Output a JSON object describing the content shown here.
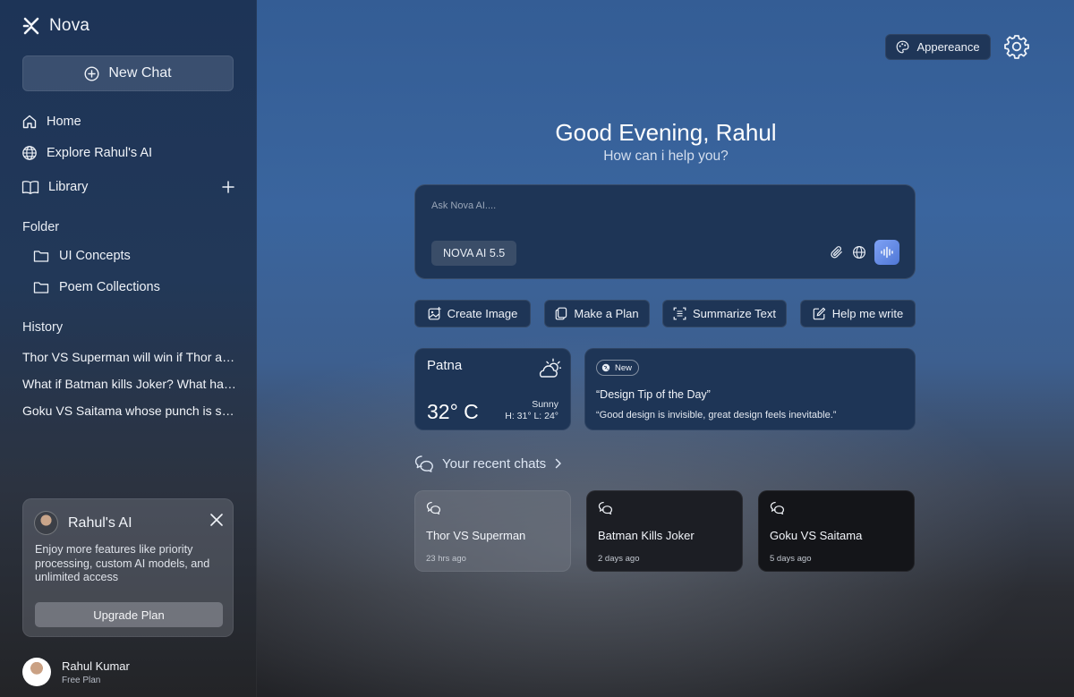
{
  "brand": {
    "name": "Nova",
    "icon": "nova-x-logo-icon"
  },
  "sidebar": {
    "new_chat": "New Chat",
    "nav": [
      {
        "label": "Home",
        "icon": "home-icon"
      },
      {
        "label": "Explore Rahul's AI",
        "icon": "globe-icon"
      },
      {
        "label": "Library",
        "icon": "book-icon"
      }
    ],
    "folder_label": "Folder",
    "folders": [
      "UI Concepts",
      "Poem Collections"
    ],
    "history_label": "History",
    "history": [
      "Thor VS Superman will win if Thor and Superman fight",
      "What if Batman kills Joker? What happens next",
      "Goku VS Saitama whose punch is stronger"
    ],
    "promo": {
      "title": "Rahul's AI",
      "description": "Enjoy more features like priority processing, custom AI models, and unlimited access",
      "button": "Upgrade Plan"
    },
    "user": {
      "name": "Rahul Kumar",
      "plan": "Free Plan"
    }
  },
  "topbar": {
    "appearance": "Appereance"
  },
  "greeting": {
    "title": "Good Evening, Rahul",
    "subtitle": "How can i help you?"
  },
  "prompt": {
    "placeholder": "Ask Nova AI....",
    "value": "",
    "model": "NOVA AI 5.5"
  },
  "actions": [
    {
      "label": "Create Image",
      "icon": "image-plus-icon"
    },
    {
      "label": "Make a Plan",
      "icon": "copy-icon"
    },
    {
      "label": "Summarize Text",
      "icon": "scan-text-icon"
    },
    {
      "label": "Help me write",
      "icon": "pencil-icon"
    }
  ],
  "weather": {
    "city": "Patna",
    "temp": "32° C",
    "condition": "Sunny",
    "range": "H: 31°  L: 24°",
    "icon": "partly-cloudy-icon"
  },
  "tip": {
    "badge": "New",
    "title": "“Design Tip of the Day”",
    "quote": "“Good design is invisible, great design feels inevitable.”"
  },
  "recent": {
    "heading": "Your recent chats",
    "chats": [
      {
        "title": "Thor VS Superman",
        "time": "23 hrs ago"
      },
      {
        "title": "Batman Kills Joker",
        "time": "2 days ago"
      },
      {
        "title": "Goku VS Saitama",
        "time": "5 days ago"
      }
    ]
  },
  "colors": {
    "accent": "#5b82e0",
    "panel": "#1e3556",
    "sidebar_top": "#1d3457"
  }
}
